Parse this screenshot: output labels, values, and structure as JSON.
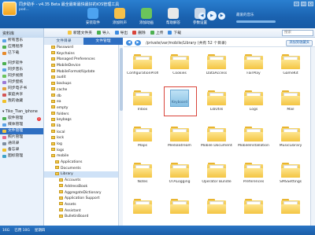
{
  "app": {
    "title": "同步助手 - v4.35 Beta 最全最新最快最好的iOS管理工具",
    "user": "pod...",
    "colors": {
      "primary": "#1a62b0",
      "accent": "#2e6fc2",
      "folder": "#f4c542",
      "selection": "#d9443a"
    }
  },
  "toolbar": {
    "items": [
      {
        "label": "安装软件",
        "icon": "install-icon",
        "color": "#4da3f0"
      },
      {
        "label": "添加铃声",
        "icon": "ringtone-icon",
        "color": "#f5c04a"
      },
      {
        "label": "添加动画",
        "icon": "video-icon",
        "color": "#6bc45b"
      },
      {
        "label": "帮助解答",
        "icon": "help-icon",
        "color": "#e8e8e8"
      },
      {
        "label": "参数设置",
        "icon": "gear-icon",
        "color": "#c9d7e8"
      }
    ]
  },
  "player": {
    "track": "最爱的音乐",
    "artist": "同步音乐"
  },
  "sidebar": {
    "device": "资料库",
    "items": [
      {
        "label": "所有音乐",
        "icon": "music-icon"
      },
      {
        "label": "应用程序",
        "icon": "app-icon"
      },
      {
        "label": "已下载",
        "icon": "download-icon"
      }
    ],
    "group2": [
      {
        "label": "同步软件",
        "icon": "app-icon"
      },
      {
        "label": "同步音乐",
        "icon": "music-icon"
      },
      {
        "label": "同步视频",
        "icon": "video-icon"
      },
      {
        "label": "同步壁纸",
        "icon": "wallpaper-icon"
      },
      {
        "label": "同步电子书",
        "icon": "book-icon"
      },
      {
        "label": "家庭共享",
        "icon": "share-icon"
      },
      {
        "label": "我的收藏",
        "icon": "star-icon"
      }
    ],
    "device_name": "Tiko_Tian_iphone",
    "device_items": [
      {
        "label": "软件管理",
        "icon": "app-icon",
        "badge": "2"
      },
      {
        "label": "媒体管理",
        "icon": "media-icon",
        "badge": ""
      },
      {
        "label": "文件管理",
        "icon": "folder-icon",
        "badge": "",
        "active": true
      },
      {
        "label": "照片管理",
        "icon": "photo-icon",
        "badge": ""
      },
      {
        "label": "通讯录",
        "icon": "contacts-icon",
        "badge": ""
      },
      {
        "label": "备忘录",
        "icon": "note-icon",
        "badge": ""
      },
      {
        "label": "图标管理",
        "icon": "icon-icon",
        "badge": ""
      }
    ]
  },
  "subbar": {
    "items": [
      "新建文件夹",
      "导入",
      "导出",
      "删除",
      "上传",
      "下载"
    ],
    "search_placeholder": "搜索"
  },
  "tabs": [
    {
      "label": "文件目录",
      "active": false
    },
    {
      "label": "文件管理",
      "active": true
    }
  ],
  "tree": [
    "Password",
    "Keychains",
    "Managed Preferences",
    "MobileDevice",
    "MobileFormat/Update",
    "audit",
    "backups",
    "cache",
    "db",
    "ea",
    "empty",
    "folders",
    "keybags",
    "lib",
    "local",
    "lock",
    "log",
    "logs",
    "mobile",
    "Applications",
    "Documents",
    "Library",
    "Accounts",
    "AddressBook",
    "AggregateDictionary",
    "Application Support",
    "Assets",
    "Assistant",
    "BulletinBoard"
  ],
  "tree_selected": "Library",
  "pathbar": {
    "path": "/private/var/mobile/Library   (共有 52 个目录)",
    "add_favorite": "添加到收藏夹"
  },
  "folders": [
    "ConfigurationProfiles",
    "Cookies",
    "DataAccess",
    "FairPlay",
    "GameKit",
    "Inbox",
    "Keyboard",
    "LibUtils",
    "Logs",
    "Mail",
    "Maps",
    "MediaStream",
    "Mobile Documents",
    "MobileInstallation",
    "MusicLibrary",
    "Notes",
    "OTALogging",
    "Operator Bundle",
    "Preferences",
    "SMSSettings",
    "",
    "",
    "",
    "",
    ""
  ],
  "selected_folder": "Keyboard",
  "status": {
    "storage": "16G",
    "free": "已用 10G",
    "date": "星期四"
  }
}
